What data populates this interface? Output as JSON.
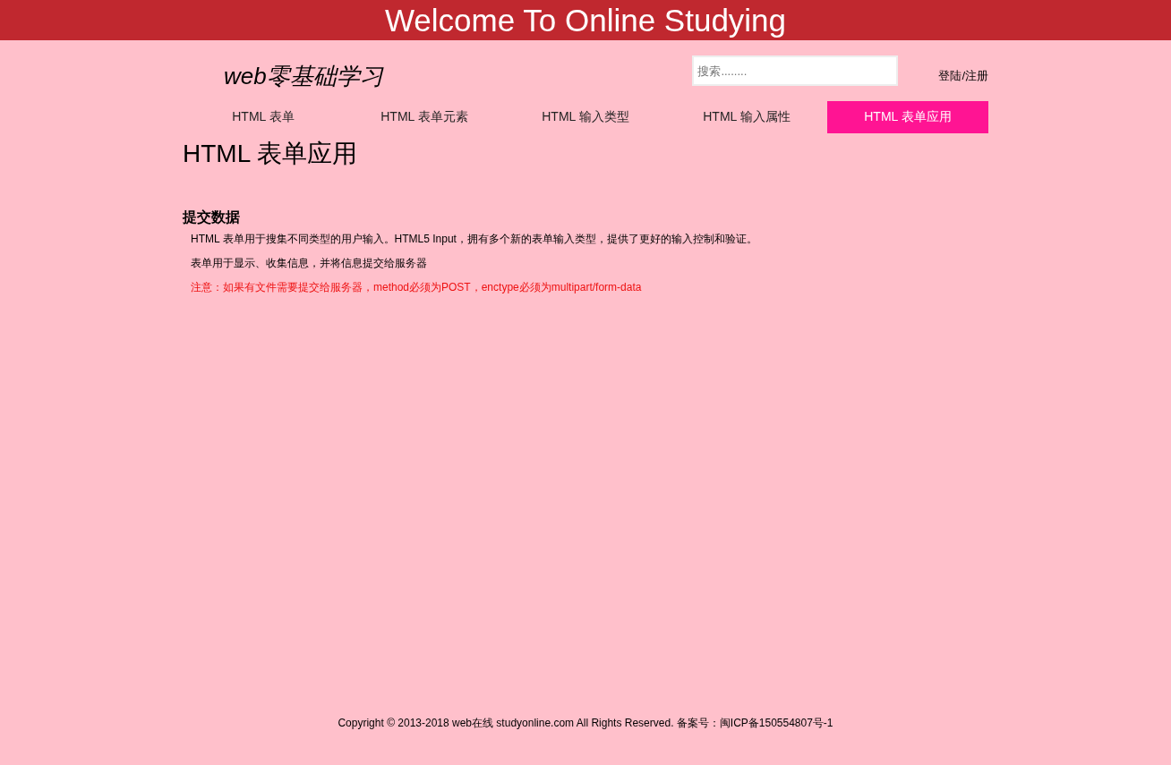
{
  "banner": {
    "title": "Welcome To Online Studying"
  },
  "header": {
    "logo": "web零基础学习",
    "search": {
      "placeholder": "搜索........"
    },
    "login_link": "登陆/注册"
  },
  "nav": [
    {
      "label": "HTML 表单",
      "selected": false
    },
    {
      "label": "HTML 表单元素",
      "selected": false
    },
    {
      "label": "HTML 输入类型",
      "selected": false
    },
    {
      "label": "HTML 输入属性",
      "selected": false
    },
    {
      "label": "HTML 表单应用",
      "selected": true
    }
  ],
  "page_title": "HTML 表单应用",
  "section": {
    "heading": "提交数据",
    "paragraphs": [
      {
        "kind": "text",
        "text": "HTML 表单用于搜集不同类型的用户输入。HTML5 Input，拥有多个新的表单输入类型，提供了更好的输入控制和验证。"
      },
      {
        "kind": "text",
        "text": "表单用于显示、收集信息，并将信息提交给服务器"
      },
      {
        "kind": "note",
        "text": "注意：如果有文件需要提交给服务器，method必须为POST，enctype必须为multipart/form-data"
      }
    ]
  },
  "footer": "Copyright © 2013-2018 web在线 studyonline.com All Rights Reserved. 备案号：闽ICP备150554807号-1"
}
